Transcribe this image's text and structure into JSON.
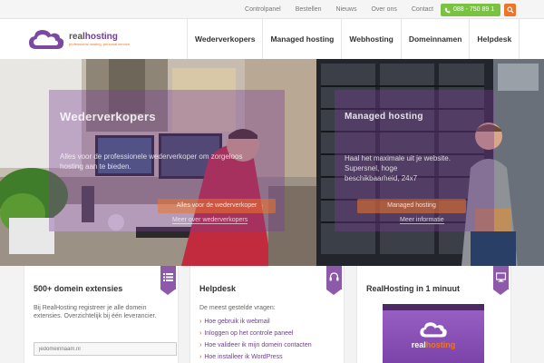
{
  "topbar": {
    "links": [
      "Controlpanel",
      "Bestellen",
      "Nieuws",
      "Over ons",
      "Contact"
    ],
    "phone": "088 - 750 89 1",
    "search_icon": "search-icon",
    "phone_icon": "phone-icon"
  },
  "brand": {
    "name_part1": "real",
    "name_part2": "hosting",
    "tagline": "professional hosting, personal service",
    "colors": {
      "purple": "#6e3f92",
      "orange": "#ee7526",
      "green": "#7cc242"
    }
  },
  "nav": {
    "items": [
      "Wederverkopers",
      "Managed hosting",
      "Webhosting",
      "Domeinnamen",
      "Helpdesk"
    ]
  },
  "hero": {
    "left": {
      "title": "Wederverkopers",
      "text": "Alles voor de professionele wederverkoper om zorgeloos hosting aan te bieden.",
      "button": "Alles voor de wederverkoper",
      "link": "Meer over wederverkopers"
    },
    "right": {
      "title": "Managed hosting",
      "text": "Haal het maximale uit je website. Supersnel, hoge beschikbaarheid, 24x7",
      "button": "Managed hosting",
      "link": "Meer informatie"
    }
  },
  "columns": {
    "domains": {
      "title": "500+ domein extensies",
      "text": "Bij RealHosting registreer je alle domein extensies. Overzichtelijk bij één leverancier.",
      "input_placeholder": "jedomeinnaam.nl",
      "icon": "list-icon"
    },
    "helpdesk": {
      "title": "Helpdesk",
      "intro": "De meest gestelde vragen:",
      "links": [
        "Hoe gebruik ik webmail",
        "Inloggen op het controle paneel",
        "Hoe valideer ik mijn domein contacten",
        "Hoe installeer ik WordPress"
      ],
      "icon": "headset-icon"
    },
    "video": {
      "title": "RealHosting in 1 minuut",
      "word_part1": "real",
      "word_part2": "hosting",
      "icon": "monitor-icon"
    }
  }
}
